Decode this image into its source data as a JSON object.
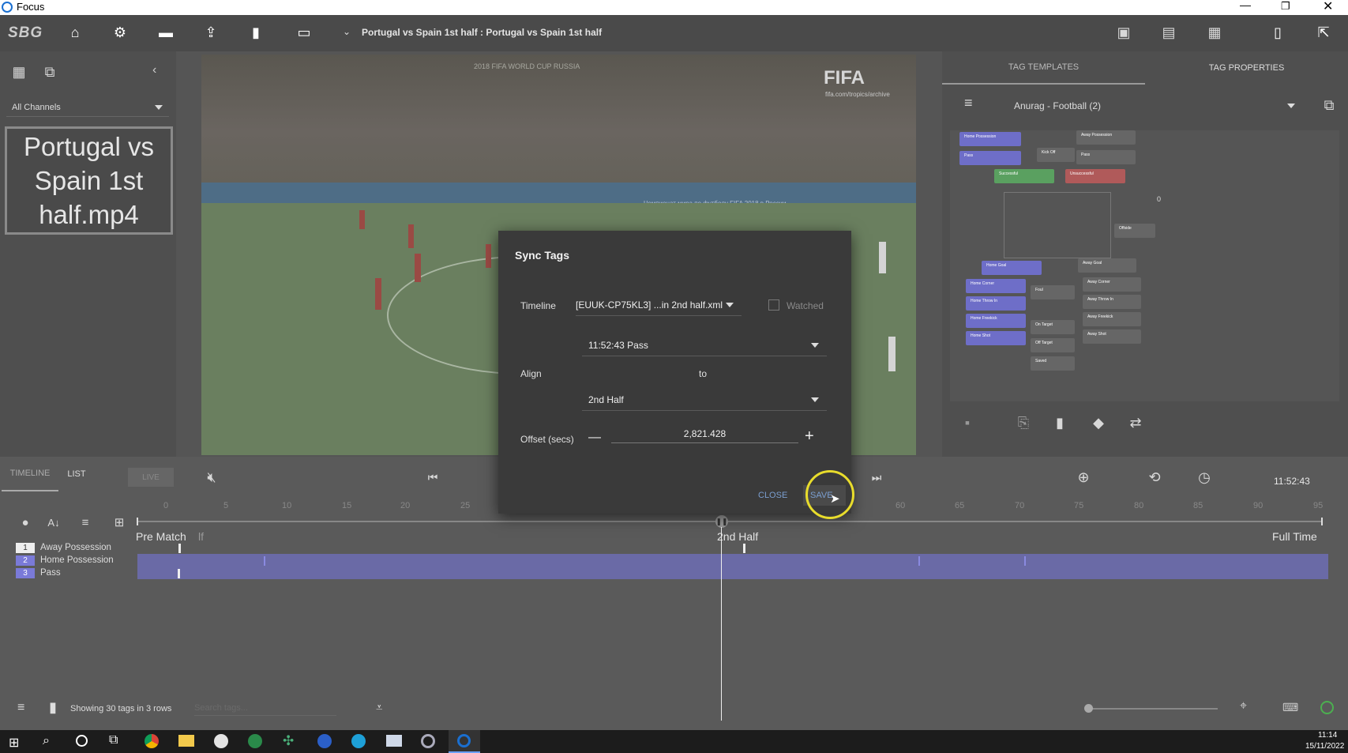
{
  "window": {
    "title": "Focus"
  },
  "toolbar": {
    "logo": "SBG",
    "project_title": "Portugal vs Spain 1st half : Portugal vs Spain 1st half"
  },
  "left_panel": {
    "channel_select": "All Channels",
    "clip_title": "Portugal vs Spain 1st half.mp4"
  },
  "video": {
    "fifa_logo": "FIFA",
    "fifa_url": "fifa.com/tropics/archive",
    "banner_text": "2018 FIFA WORLD CUP RUSSIA",
    "board_text": "Чемпионат мира по футболу FIFA 2018 в России"
  },
  "right_panel": {
    "tabs": [
      "TAG TEMPLATES",
      "TAG PROPERTIES"
    ],
    "template_select": "Anurag - Football (2)",
    "mini_tags": {
      "home_possession": "Home Possession",
      "pass": "Pass",
      "kick_off": "Kick Off",
      "away_possession": "Away Possession",
      "pass2": "Pass",
      "successful": "Successful",
      "unsuccessful": "Unsuccessful",
      "counter": "0",
      "home_goal": "Home Goal",
      "away_goal": "Away Goal",
      "home_corner": "Home Corner",
      "home_throw_in": "Home Throw In",
      "home_freekick": "Home Freekick",
      "home_shot": "Home Shot",
      "foul": "Foul",
      "offside": "Offside",
      "on_target": "On Target",
      "off_target": "Off Target",
      "saved": "Saved",
      "away_corner": "Away Corner",
      "away_throw_in": "Away Throw In",
      "away_freekick": "Away Freekick",
      "away_shot": "Away Shot"
    }
  },
  "dialog": {
    "title": "Sync Tags",
    "timeline_label": "Timeline",
    "timeline_value": "[EUUK-CP75KL3] ...in 2nd half.xml",
    "watched_label": "Watched",
    "tag_value": "11:52:43 Pass",
    "align_label": "Align",
    "to_label": "to",
    "align_value": "2nd Half",
    "offset_label": "Offset (secs)",
    "offset_value": "2,821.428",
    "minus": "—",
    "plus": "+",
    "close_label": "CLOSE",
    "save_label": "SAVE"
  },
  "timeline": {
    "tabs": [
      "TIMELINE",
      "LIST"
    ],
    "live_label": "LIVE",
    "time": "11:52:43",
    "ticks": [
      "0",
      "5",
      "10",
      "15",
      "20",
      "25",
      "60",
      "65",
      "70",
      "75",
      "80",
      "85",
      "90",
      "95"
    ],
    "markers": {
      "pre_match": "Pre Match",
      "half": "lf",
      "second_half": "2nd Half",
      "full_time": "Full Time"
    },
    "rows": [
      {
        "num": "1",
        "name": "Away Possession"
      },
      {
        "num": "2",
        "name": "Home Possession"
      },
      {
        "num": "3",
        "name": "Pass"
      }
    ],
    "status": "Showing 30 tags in 3 rows",
    "search_placeholder": "Search tags..."
  },
  "taskbar": {
    "time": "11:14",
    "date": "15/11/2022"
  }
}
